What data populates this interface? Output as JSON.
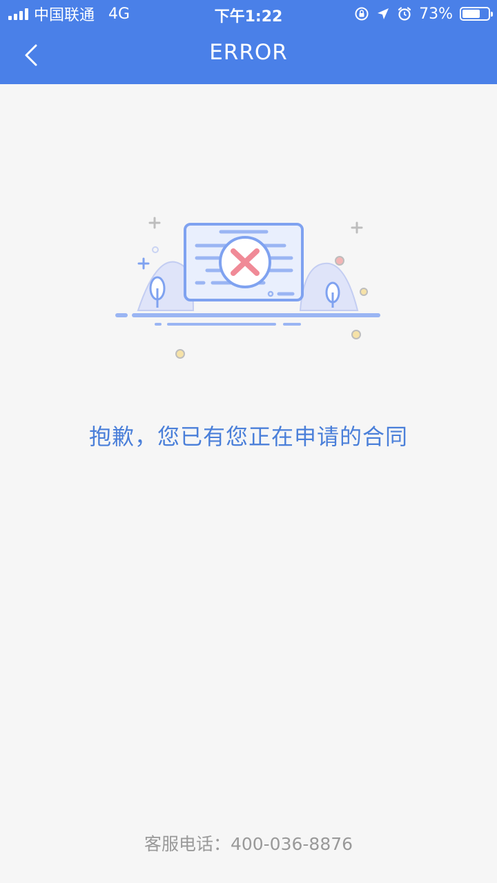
{
  "status_bar": {
    "carrier": "中国联通",
    "network": "4G",
    "time": "下午1:22",
    "battery_percent": "73%",
    "battery_level": 0.73,
    "icons": [
      "orientation-lock-icon",
      "location-arrow-icon",
      "alarm-icon"
    ]
  },
  "header": {
    "title": "ERROR",
    "back_icon": "chevron-left-icon",
    "background_color": "#4a80e8"
  },
  "main": {
    "illustration_icon": "error-document-icon",
    "message": "抱歉，您已有您正在申请的合同",
    "message_color": "#4a7fd9"
  },
  "footer": {
    "hotline": "客服电话：400-036-8876"
  }
}
